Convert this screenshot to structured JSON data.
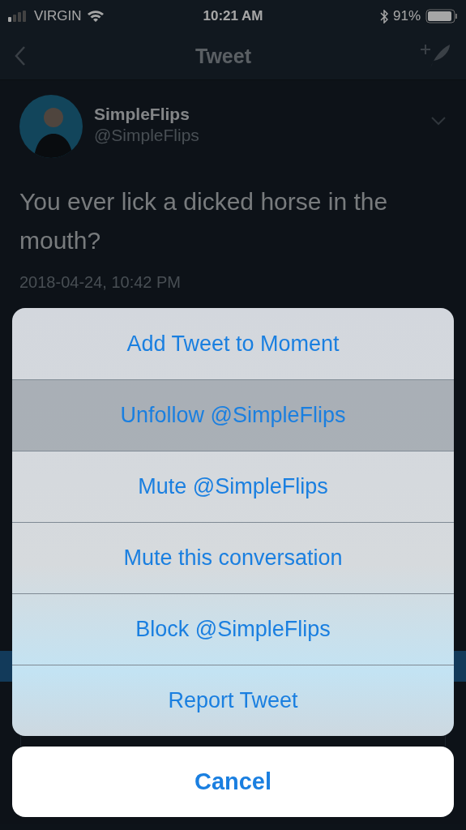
{
  "status_bar": {
    "carrier": "VIRGIN",
    "time": "10:21 AM",
    "battery": "91%"
  },
  "nav_bar": {
    "title": "Tweet"
  },
  "tweet": {
    "name": "SimpleFlips",
    "handle": "@SimpleFlips",
    "text": "You ever lick a dicked horse in the mouth?",
    "timestamp": "2018-04-24, 10:42 PM"
  },
  "action_sheet": {
    "actions": [
      {
        "label": "Add Tweet to Moment",
        "selected": false
      },
      {
        "label": "Unfollow @SimpleFlips",
        "selected": true
      },
      {
        "label": "Mute @SimpleFlips",
        "selected": false
      },
      {
        "label": "Mute this conversation",
        "selected": false
      },
      {
        "label": "Block @SimpleFlips",
        "selected": false
      },
      {
        "label": "Report Tweet",
        "selected": false
      }
    ],
    "cancel": "Cancel"
  }
}
